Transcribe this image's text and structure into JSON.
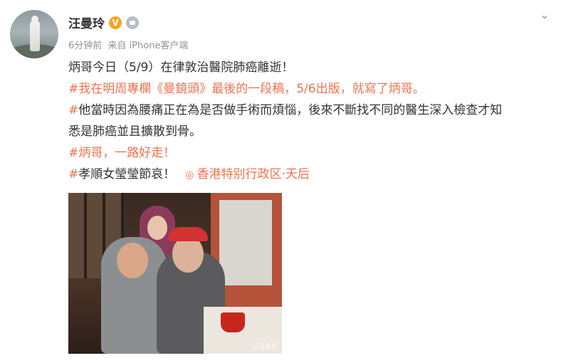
{
  "user": {
    "name": "汪曼玲",
    "verified_badge": "V",
    "member_icon": "member-icon"
  },
  "meta": {
    "time": "6分钟前",
    "source": "来自 iPhone客户端"
  },
  "post": {
    "line1": "炳哥今日（5/9）在律敦治醫院肺癌離逝！",
    "line2": "#我在明周專欄《曼鏡頭》最後的一段稿，5/6出版，就寫了炳哥。",
    "line3_tag": "#",
    "line3_text": "他當時因為腰痛正在為是否做手術而煩惱，後來不斷找不同的醫生深入檢查才知",
    "line4": "悉是肺癌並且擴散到骨。",
    "line5": "#炳哥，一路好走！",
    "line6_tag": "#",
    "line6_text": "孝順女瑩瑩節哀！",
    "location_icon": "◎",
    "location": "香港特别行政区·天后"
  },
  "image": {
    "watermark": "@汪曼玲"
  },
  "colors": {
    "accent": "#eb7350",
    "text": "#333333",
    "meta": "#939393"
  }
}
